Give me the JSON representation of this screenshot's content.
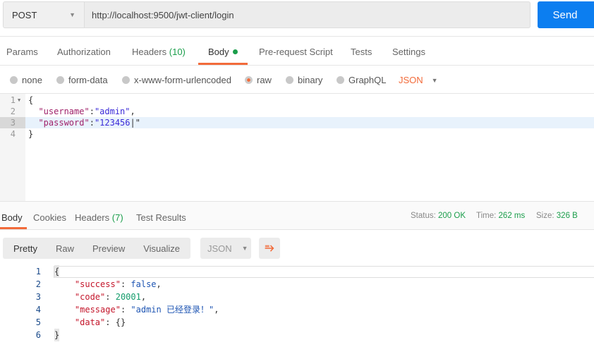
{
  "request": {
    "method": "POST",
    "url": "http://localhost:9500/jwt-client/login",
    "send_label": "Send"
  },
  "tabs": [
    {
      "label": "Params"
    },
    {
      "label": "Authorization"
    },
    {
      "label": "Headers",
      "count": "(10)"
    },
    {
      "label": "Body"
    },
    {
      "label": "Pre-request Script"
    },
    {
      "label": "Tests"
    },
    {
      "label": "Settings"
    }
  ],
  "body_types": [
    "none",
    "form-data",
    "x-www-form-urlencoded",
    "raw",
    "binary",
    "GraphQL"
  ],
  "body_format": "JSON",
  "request_body": {
    "lines": [
      "{",
      "  \"username\":\"admin\",",
      "  \"password\":\"123456\"",
      "}"
    ],
    "line_numbers": [
      "1",
      "2",
      "3",
      "4"
    ]
  },
  "response": {
    "tabs": [
      {
        "label": "Body"
      },
      {
        "label": "Cookies"
      },
      {
        "label": "Headers",
        "count": "(7)"
      },
      {
        "label": "Test Results"
      }
    ],
    "status_label": "Status:",
    "status": "200 OK",
    "time_label": "Time:",
    "time": "262 ms",
    "size_label": "Size:",
    "size": "326 B",
    "view_modes": [
      "Pretty",
      "Raw",
      "Preview",
      "Visualize"
    ],
    "format": "JSON",
    "line_numbers": [
      "1",
      "2",
      "3",
      "4",
      "5",
      "6"
    ],
    "json": {
      "success": "false",
      "code": "20001",
      "message": "\"admin 已经登录！\"",
      "data": "{}"
    }
  },
  "colors": {
    "accent": "#f26b3a",
    "send": "#0c7ef0",
    "success": "#1b9e4b"
  }
}
